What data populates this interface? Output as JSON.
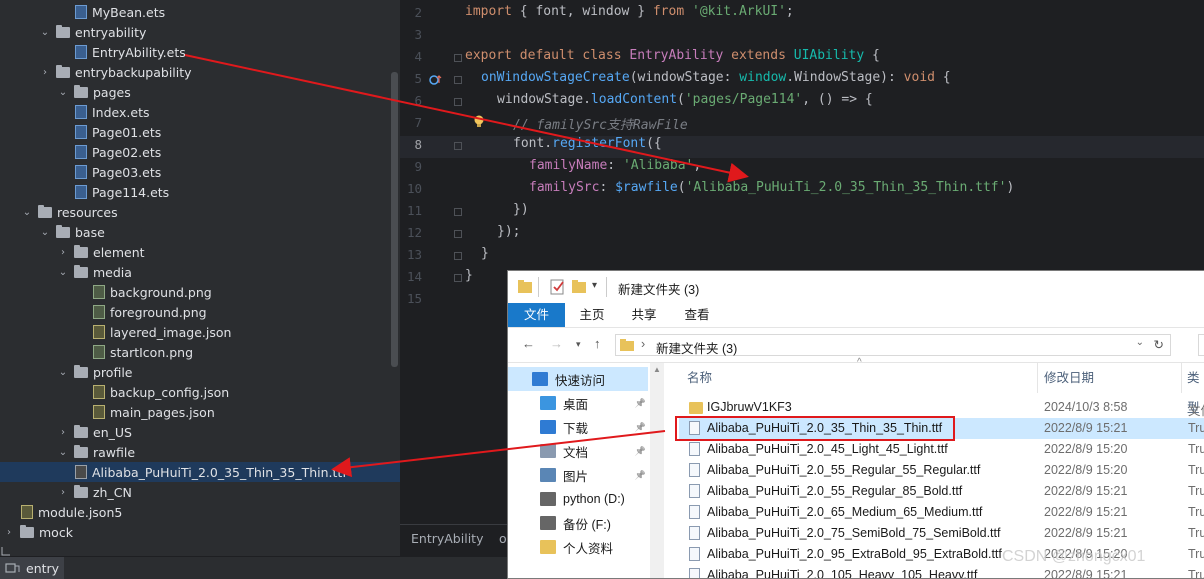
{
  "project_tree": {
    "rows": [
      {
        "label": "MyBean.ets",
        "kind": "ets"
      },
      {
        "label": "entryability",
        "kind": "folder",
        "open": true
      },
      {
        "label": "EntryAbility.ets",
        "kind": "ets"
      },
      {
        "label": "entrybackupability",
        "kind": "folder",
        "open": false
      },
      {
        "label": "pages",
        "kind": "folder",
        "open": true
      },
      {
        "label": "Index.ets",
        "kind": "ets"
      },
      {
        "label": "Page01.ets",
        "kind": "ets"
      },
      {
        "label": "Page02.ets",
        "kind": "ets"
      },
      {
        "label": "Page03.ets",
        "kind": "ets"
      },
      {
        "label": "Page114.ets",
        "kind": "ets"
      },
      {
        "label": "resources",
        "kind": "folder",
        "open": true
      },
      {
        "label": "base",
        "kind": "folder",
        "open": true
      },
      {
        "label": "element",
        "kind": "folder",
        "open": false
      },
      {
        "label": "media",
        "kind": "folder",
        "open": true
      },
      {
        "label": "background.png",
        "kind": "png"
      },
      {
        "label": "foreground.png",
        "kind": "png"
      },
      {
        "label": "layered_image.json",
        "kind": "json"
      },
      {
        "label": "startIcon.png",
        "kind": "png"
      },
      {
        "label": "profile",
        "kind": "folder",
        "open": true
      },
      {
        "label": "backup_config.json",
        "kind": "json"
      },
      {
        "label": "main_pages.json",
        "kind": "json"
      },
      {
        "label": "en_US",
        "kind": "folder",
        "open": false
      },
      {
        "label": "rawfile",
        "kind": "folder",
        "open": true
      },
      {
        "label": "Alibaba_PuHuiTi_2.0_35_Thin_35_Thin.ttf",
        "kind": "ttf",
        "selected": true
      },
      {
        "label": "zh_CN",
        "kind": "folder",
        "open": false
      },
      {
        "label": "module.json5",
        "kind": "json"
      },
      {
        "label": "mock",
        "kind": "folder",
        "open": false
      }
    ]
  },
  "editor": {
    "line_numbers": [
      "2",
      "3",
      "4",
      "5",
      "6",
      "7",
      "8",
      "9",
      "10",
      "11",
      "12",
      "13",
      "14",
      "15"
    ],
    "active_line": "8",
    "breadcrumb": "EntryAbility",
    "breadcrumb_more": "o"
  },
  "code": {
    "l2": {
      "kw1": "import",
      "p1": " { font, window } ",
      "kw2": "from",
      "str": " '@kit.ArkUI'",
      "end": ";"
    },
    "l4": {
      "kw1": "export default class",
      "cls": " EntryAbility",
      "kw2": " extends",
      "type": " UIAbility",
      "end": " {"
    },
    "l5": {
      "fn": "onWindowStageCreate",
      "p1": "(windowStage: ",
      "type": "window",
      "p2": ".WindowStage): ",
      "kw": "void",
      "end": " {"
    },
    "l6": {
      "p1": "windowStage.",
      "fn": "loadContent",
      "p2": "(",
      "str": "'pages/Page114'",
      "p3": ", () => {"
    },
    "l7": {
      "cmt": "// familySrc支持RawFile"
    },
    "l8": {
      "p1": "font.",
      "fn": "registerFont",
      "p2": "({"
    },
    "l9": {
      "prop": "familyName",
      "p1": ": ",
      "str": "'Alibaba'",
      "end": ","
    },
    "l10": {
      "prop": "familySrc",
      "p1": ": ",
      "fn": "$rawfile",
      "p2": "(",
      "str": "'Alibaba_PuHuiTi_2.0_35_Thin_35_Thin.ttf'",
      "end": ")"
    },
    "l11": {
      "text": "})"
    },
    "l12": {
      "text": "});"
    },
    "l13": {
      "text": "}"
    },
    "l14": {
      "text": "}"
    }
  },
  "explorer": {
    "title": "新建文件夹 (3)",
    "ribbon": {
      "file": "文件",
      "home": "主页",
      "share": "共享",
      "view": "查看"
    },
    "address": "新建文件夹 (3)",
    "sidebar": [
      {
        "label": "快速访问",
        "icon": "star-icon",
        "color": "#2f7bd3",
        "selected": true
      },
      {
        "label": "桌面",
        "icon": "desktop-icon",
        "color": "#3b95e0",
        "pinned": true
      },
      {
        "label": "下载",
        "icon": "download-icon",
        "color": "#2f7bd3",
        "pinned": true
      },
      {
        "label": "文档",
        "icon": "document-icon",
        "color": "#8a9ab0",
        "pinned": true
      },
      {
        "label": "图片",
        "icon": "picture-icon",
        "color": "#5a86b5",
        "pinned": true
      },
      {
        "label": "python (D:)",
        "icon": "drive-icon",
        "color": "#666666"
      },
      {
        "label": "备份 (F:)",
        "icon": "drive-icon",
        "color": "#666666"
      },
      {
        "label": "个人资料",
        "icon": "folder-icon",
        "color": "#e8c25a"
      }
    ],
    "columns": {
      "name": "名称",
      "date": "修改日期",
      "type": "类型"
    },
    "files": [
      {
        "name": "IGJbruwV1KF3",
        "date": "2024/10/3 8:58",
        "type": "文件",
        "kind": "folder"
      },
      {
        "name": "Alibaba_PuHuiTi_2.0_35_Thin_35_Thin.ttf",
        "date": "2022/8/9 15:21",
        "type": "True",
        "kind": "ttf",
        "selected": true
      },
      {
        "name": "Alibaba_PuHuiTi_2.0_45_Light_45_Light.ttf",
        "date": "2022/8/9 15:20",
        "type": "True",
        "kind": "ttf"
      },
      {
        "name": "Alibaba_PuHuiTi_2.0_55_Regular_55_Regular.ttf",
        "date": "2022/8/9 15:20",
        "type": "True",
        "kind": "ttf"
      },
      {
        "name": "Alibaba_PuHuiTi_2.0_55_Regular_85_Bold.ttf",
        "date": "2022/8/9 15:21",
        "type": "True",
        "kind": "ttf"
      },
      {
        "name": "Alibaba_PuHuiTi_2.0_65_Medium_65_Medium.ttf",
        "date": "2022/8/9 15:21",
        "type": "True",
        "kind": "ttf"
      },
      {
        "name": "Alibaba_PuHuiTi_2.0_75_SemiBold_75_SemiBold.ttf",
        "date": "2022/8/9 15:21",
        "type": "True",
        "kind": "ttf"
      },
      {
        "name": "Alibaba_PuHuiTi_2.0_95_ExtraBold_95_ExtraBold.ttf",
        "date": "2022/8/9 15:20",
        "type": "True",
        "kind": "ttf"
      },
      {
        "name": "Alibaba_PuHuiTi_2.0_105_Heavy_105_Heavy.ttf",
        "date": "2022/8/9 15:21",
        "type": "True",
        "kind": "ttf"
      }
    ]
  },
  "bottom_bar": {
    "tab": "entry"
  },
  "watermark": "CSDN @zhongcx01",
  "colors": {
    "annotation_arrow": "#e0191c",
    "selection_blue": "#cce8ff",
    "ribbon_blue": "#1979ca"
  }
}
